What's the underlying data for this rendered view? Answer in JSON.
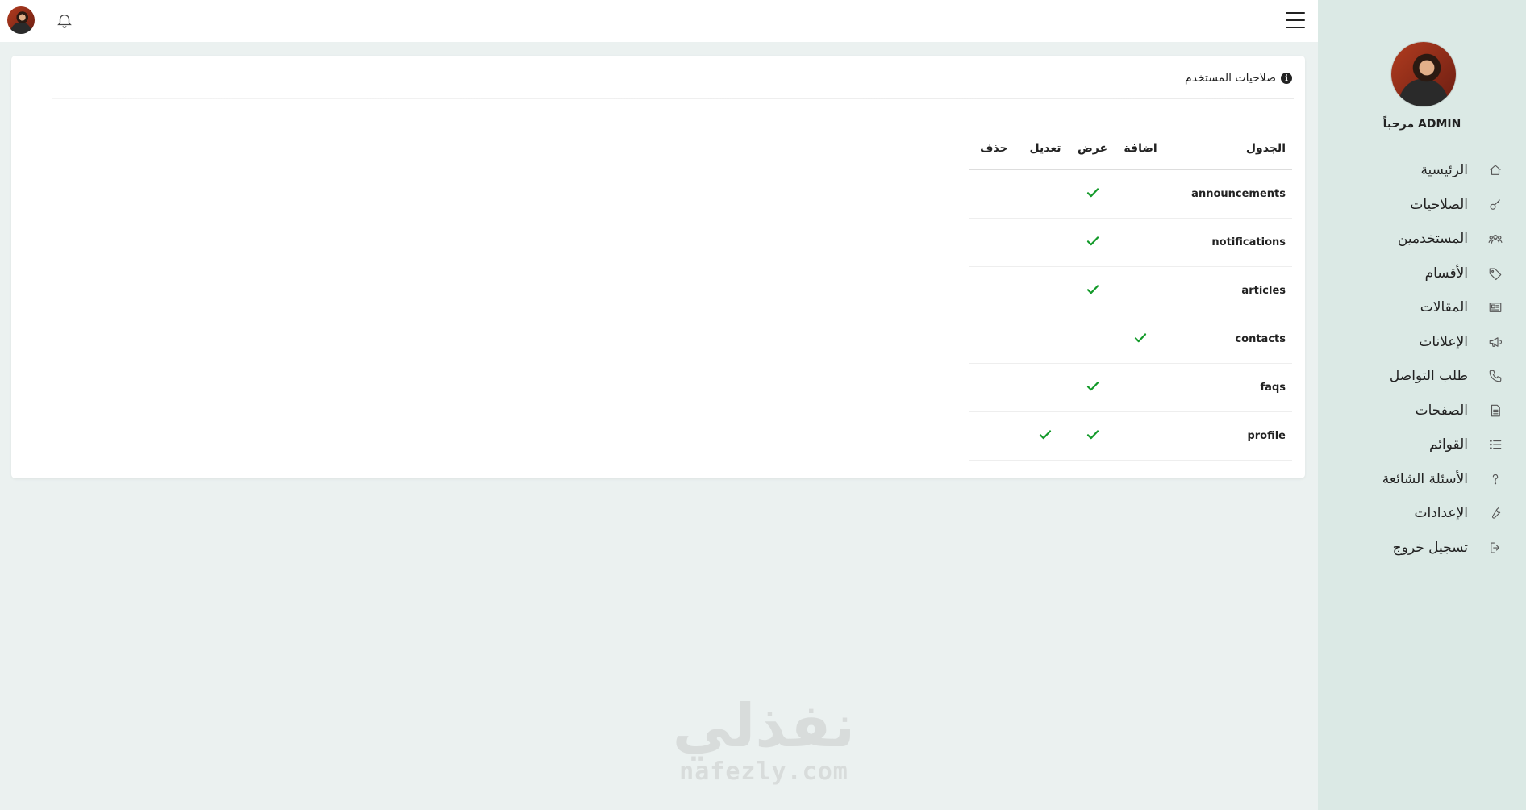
{
  "colors": {
    "background": "#ebf1f0",
    "sidebar": "#dbe9e5",
    "check": "#139a2a"
  },
  "sidebar": {
    "welcome": "مرحباً ADMIN",
    "items": [
      {
        "label": "الرئيسية",
        "icon": "home-icon"
      },
      {
        "label": "الصلاحيات",
        "icon": "key-icon"
      },
      {
        "label": "المستخدمين",
        "icon": "users-icon"
      },
      {
        "label": "الأقسام",
        "icon": "tag-icon"
      },
      {
        "label": "المقالات",
        "icon": "newspaper-icon"
      },
      {
        "label": "الإعلانات",
        "icon": "megaphone-icon"
      },
      {
        "label": "طلب التواصل",
        "icon": "phone-icon"
      },
      {
        "label": "الصفحات",
        "icon": "file-icon"
      },
      {
        "label": "القوائم",
        "icon": "list-icon"
      },
      {
        "label": "الأسئلة الشائعة",
        "icon": "question-icon"
      },
      {
        "label": "الإعدادات",
        "icon": "wrench-icon"
      },
      {
        "label": "تسجيل خروج",
        "icon": "logout-icon"
      }
    ]
  },
  "topbar": {
    "icons": [
      "avatar",
      "bell-icon",
      "hamburger-menu-icon"
    ]
  },
  "card": {
    "title": "صلاحيات المستخدم",
    "icon": "info-icon"
  },
  "table": {
    "headers": {
      "table": "الجدول",
      "add": "اضافة",
      "view": "عرض",
      "edit": "تعديل",
      "delete": "حذف"
    },
    "rows": [
      {
        "name": "announcements",
        "add": false,
        "view": true,
        "edit": false,
        "delete": false
      },
      {
        "name": "notifications",
        "add": false,
        "view": true,
        "edit": false,
        "delete": false
      },
      {
        "name": "articles",
        "add": false,
        "view": true,
        "edit": false,
        "delete": false
      },
      {
        "name": "contacts",
        "add": true,
        "view": false,
        "edit": false,
        "delete": false
      },
      {
        "name": "faqs",
        "add": false,
        "view": true,
        "edit": false,
        "delete": false
      },
      {
        "name": "profile",
        "add": false,
        "view": true,
        "edit": true,
        "delete": false
      }
    ]
  },
  "watermark": {
    "arabic": "نفذلي",
    "latin": "nafezly.com"
  }
}
